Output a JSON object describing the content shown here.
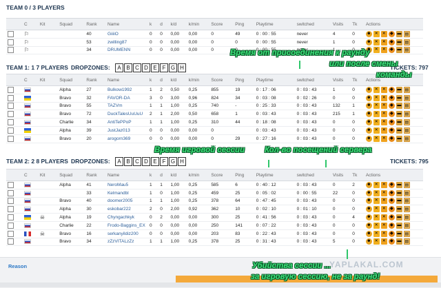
{
  "team0": {
    "title": "TEAM 0 / 3 PLAYERS",
    "columns": [
      "C",
      "Kit",
      "Squad",
      "Rank",
      "Name",
      "k",
      "d",
      "k/d",
      "k/min",
      "Score",
      "Ping",
      "Playtime",
      "switched",
      "Visits",
      "Tk",
      "Actions"
    ],
    "rows": [
      {
        "rank": "40",
        "name": "GiiiiO",
        "k": "0",
        "d": "0",
        "kd": "0,00",
        "kmin": "0,00",
        "score": "0",
        "ping": "49",
        "playtime": "0 : 00 : 55",
        "switched": "never",
        "visits": "4",
        "tk": "0"
      },
      {
        "rank": "53",
        "name": "zwilling87",
        "k": "0",
        "d": "0",
        "kd": "0,00",
        "kmin": "0,00",
        "score": "0",
        "ping": "0",
        "playtime": "0 : 00 : 55",
        "switched": "never",
        "visits": "1",
        "tk": "0"
      },
      {
        "rank": "34",
        "name": "DRUMENN",
        "k": "0",
        "d": "0",
        "kd": "0,00",
        "kmin": "0,00",
        "score": "0",
        "ping": "0",
        "playtime": "0 : 00 : 55",
        "switched": "never",
        "visits": "1",
        "tk": "0"
      }
    ]
  },
  "team1": {
    "title": "TEAM 1: 1 7 PLAYERS",
    "dropzones_label": "DROPZONES:",
    "dropzones": [
      "A",
      "B",
      "C",
      "D",
      "E",
      "F",
      "G",
      "H"
    ],
    "tickets": "TICKETS: 797",
    "columns": [
      "C",
      "Kit",
      "Squad",
      "Rank",
      "Name",
      "k",
      "d",
      "k/d",
      "k/min",
      "Score",
      "Ping",
      "Playtime",
      "switched",
      "Visits",
      "Tk",
      "Actions"
    ],
    "rows": [
      {
        "flag": "ru",
        "squad": "Alpha",
        "rank": "27",
        "name": "Bulkow1992",
        "k": "1",
        "d": "2",
        "kd": "0,50",
        "kmin": "0,25",
        "score": "855",
        "ping": "19",
        "playtime": "0 : 17 : 06",
        "switched": "0 : 03 : 43",
        "visits": "1",
        "tk": "0"
      },
      {
        "flag": "ua",
        "squad": "Bravo",
        "rank": "32",
        "name": "FAVOR-DA",
        "k": "3",
        "d": "0",
        "kd": "3,00",
        "kmin": "0,96",
        "score": "824",
        "ping": "34",
        "playtime": "0 : 03 : 08",
        "switched": "0 : 02 : 26",
        "visits": "0",
        "tk": "0"
      },
      {
        "flag": "ru",
        "squad": "Bravo",
        "rank": "55",
        "name": "TAZVm",
        "k": "1",
        "d": "1",
        "kd": "1,00",
        "kmin": "0,25",
        "score": "740",
        "ping": "-",
        "playtime": "0 : 25 : 33",
        "switched": "0 : 03 : 43",
        "visits": "132",
        "tk": "1"
      },
      {
        "flag": "ru",
        "squad": "Bravo",
        "rank": "72",
        "name": "DuckTalesUuUuU",
        "k": "2",
        "d": "1",
        "kd": "2,00",
        "kmin": "0,50",
        "score": "658",
        "ping": "1",
        "playtime": "0 : 03 : 43",
        "switched": "0 : 03 : 43",
        "visits": "215",
        "tk": "1"
      },
      {
        "flag": "ru",
        "squad": "Charlie",
        "rank": "34",
        "name": "AntiTePPoP",
        "k": "1",
        "d": "1",
        "kd": "1,00",
        "kmin": "0,25",
        "score": "310",
        "ping": "44",
        "playtime": "0 : 18 : 08",
        "switched": "0 : 03 : 43",
        "visits": "0",
        "tk": "0"
      },
      {
        "flag": "ua",
        "squad": "Alpha",
        "rank": "39",
        "name": "JustJaz013",
        "k": "0",
        "d": "0",
        "kd": "0,00",
        "kmin": "0,00",
        "score": "0",
        "ping": "",
        "playtime": "0 : 03 : 43",
        "switched": "0 : 03 : 43",
        "visits": "0",
        "tk": "0"
      },
      {
        "flag": "ru",
        "squad": "Bravo",
        "rank": "20",
        "name": "arogorn369",
        "k": "0",
        "d": "0",
        "kd": "0,00",
        "kmin": "0,00",
        "score": "0",
        "ping": "29",
        "playtime": "0 : 27 : 16",
        "switched": "0 : 03 : 43",
        "visits": "0",
        "tk": "0"
      }
    ]
  },
  "team2": {
    "title": "TEAM 2: 2 8 PLAYERS",
    "dropzones_label": "DROPZONES:",
    "dropzones": [
      "A",
      "B",
      "C",
      "D",
      "E",
      "F",
      "G",
      "H"
    ],
    "tickets": "TICKETS: 795",
    "columns": [
      "C",
      "Kit",
      "Squad",
      "Rank",
      "Name",
      "k",
      "d",
      "k/d",
      "k/min",
      "Score",
      "Ping",
      "Playtime",
      "switched",
      "Visits",
      "Tk",
      "Actions"
    ],
    "rows": [
      {
        "flag": "ru",
        "kit": "",
        "squad": "Alpha",
        "rank": "41",
        "name": "NeroMau5",
        "k": "1",
        "d": "1",
        "kd": "1,00",
        "kmin": "0,25",
        "score": "585",
        "ping": "6",
        "playtime": "0 : 40 : 12",
        "switched": "0 : 03 : 43",
        "visits": "0",
        "tk": "2"
      },
      {
        "flag": "ru",
        "kit": "",
        "squad": "",
        "rank": "33",
        "name": "Kelmandbl",
        "k": "1",
        "d": "0",
        "kd": "1,00",
        "kmin": "0,25",
        "score": "459",
        "ping": "25",
        "playtime": "0 : 05 : 02",
        "switched": "0 : 00 : 55",
        "visits": "22",
        "tk": "0"
      },
      {
        "flag": "ru",
        "kit": "",
        "squad": "Bravo",
        "rank": "40",
        "name": "doomer2005",
        "k": "1",
        "d": "1",
        "kd": "1,00",
        "kmin": "0,25",
        "score": "378",
        "ping": "64",
        "playtime": "0 : 47 : 45",
        "switched": "0 : 03 : 43",
        "visits": "0",
        "tk": "0"
      },
      {
        "flag": "ru",
        "kit": "",
        "squad": "Alpha",
        "rank": "30",
        "name": "eskobar222",
        "k": "2",
        "d": "0",
        "kd": "2,00",
        "kmin": "0,92",
        "score": "362",
        "ping": "10",
        "playtime": "0 : 02 : 10",
        "switched": "0 : 01 : 10",
        "visits": "0",
        "tk": "0"
      },
      {
        "flag": "ua",
        "kit": "skull",
        "squad": "Alpha",
        "rank": "19",
        "name": "Chyngachkyk",
        "k": "0",
        "d": "2",
        "kd": "0,00",
        "kmin": "0,00",
        "score": "300",
        "ping": "25",
        "playtime": "0 : 41 : 56",
        "switched": "0 : 03 : 43",
        "visits": "0",
        "tk": "4"
      },
      {
        "flag": "ru",
        "kit": "",
        "squad": "Charlie",
        "rank": "22",
        "name": "Frodo-Baggins_EX",
        "k": "0",
        "d": "0",
        "kd": "0,00",
        "kmin": "0,00",
        "score": "250",
        "ping": "141",
        "playtime": "0 : 07 : 22",
        "switched": "0 : 03 : 43",
        "visits": "0",
        "tk": "0"
      },
      {
        "flag": "fr",
        "kit": "skull",
        "squad": "Bravo",
        "rank": "16",
        "name": "serkanyildiz200",
        "k": "0",
        "d": "0",
        "kd": "0,00",
        "kmin": "0,00",
        "score": "203",
        "ping": "83",
        "playtime": "0 : 22 : 43",
        "switched": "0 : 03 : 43",
        "visits": "0",
        "tk": "0"
      },
      {
        "flag": "ru",
        "kit": "",
        "squad": "Bravo",
        "rank": "34",
        "name": "zZzVITALzZz",
        "k": "1",
        "d": "1",
        "kd": "1,00",
        "kmin": "0,25",
        "score": "378",
        "ping": "25",
        "playtime": "0 : 31 : 43",
        "switched": "0 : 03 : 43",
        "visits": "5",
        "tk": "0"
      }
    ]
  },
  "annotations": {
    "join_time_1": "Время от присоединения к раунду",
    "join_time_2": "или после смены",
    "join_time_3": "команды",
    "session_time": "Время игровой сессии",
    "visits_count": "Кол-во посещений сервера",
    "kills_1": "Убийства сессии ...",
    "kills_2": "за игровую сессию, не за раунд!"
  },
  "reason": {
    "label": "Reason"
  },
  "watermark": "YAPLAKAL.COM",
  "colors": {
    "overlay_text": "#3ee07a",
    "header_text": "#1d3550",
    "name_link": "#2c5e99",
    "reason_bar": "#f4a93a"
  }
}
